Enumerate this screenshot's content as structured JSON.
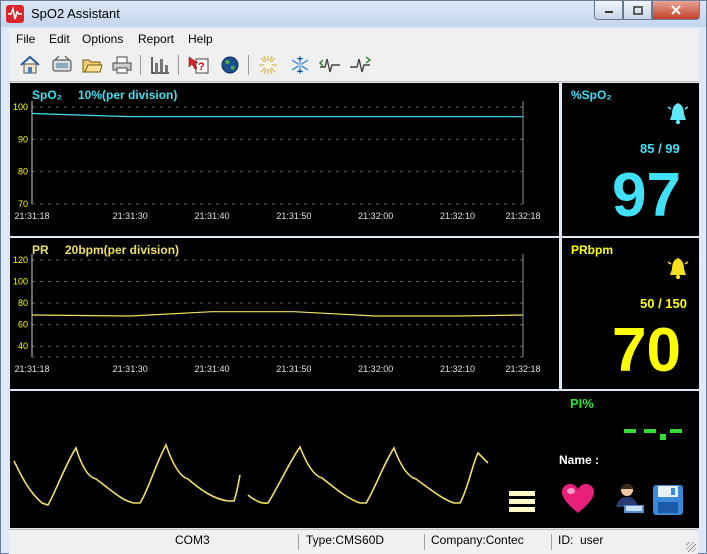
{
  "window": {
    "title": "SpO2 Assistant"
  },
  "menu": [
    "File",
    "Edit",
    "Options",
    "Report",
    "Help"
  ],
  "toolbar": [
    "home-icon",
    "device-icon",
    "open-folder-icon",
    "print-icon",
    "chart-bar-icon",
    "help-cursor-icon",
    "globe-icon",
    "sun-icon",
    "snowflake-icon",
    "waveform-left-icon",
    "waveform-right-icon"
  ],
  "spo2_graph": {
    "title": "SpO₂",
    "division": "10%(per division)",
    "y_ticks": [
      "100",
      "90",
      "80",
      "70"
    ],
    "x_ticks": [
      "21:31:18",
      "21:31:30",
      "21:31:40",
      "21:31:50",
      "21:32:00",
      "21:32:10",
      "21:32:18"
    ],
    "ylim": [
      70,
      100
    ],
    "line_color": "#40e0f0"
  },
  "pr_graph": {
    "title": "PR",
    "division": "20bpm(per division)",
    "y_ticks": [
      "120",
      "100",
      "80",
      "60",
      "40"
    ],
    "x_ticks": [
      "21:31:18",
      "21:31:30",
      "21:31:40",
      "21:31:50",
      "21:32:00",
      "21:32:10",
      "21:32:18"
    ],
    "ylim": [
      30,
      120
    ],
    "line_color": "#f0e060"
  },
  "chart_data": [
    {
      "type": "line",
      "title": "SpO₂ 10%(per division)",
      "x": [
        "21:31:18",
        "21:31:30",
        "21:31:40",
        "21:31:50",
        "21:32:00",
        "21:32:10",
        "21:32:18"
      ],
      "series": [
        {
          "values": [
            98,
            97,
            97,
            97,
            97,
            97,
            97
          ]
        }
      ],
      "ylim": [
        70,
        100
      ]
    },
    {
      "type": "line",
      "title": "PR 20bpm(per division)",
      "x": [
        "21:31:18",
        "21:31:30",
        "21:31:40",
        "21:31:50",
        "21:32:00",
        "21:32:10",
        "21:32:18"
      ],
      "series": [
        {
          "values": [
            69,
            68,
            72,
            72,
            68,
            68,
            69
          ]
        }
      ],
      "ylim": [
        30,
        120
      ]
    }
  ],
  "spo2_panel": {
    "label": "%SpO₂",
    "limits": "85 / 99",
    "value": "97",
    "color": "#40e0f8"
  },
  "pr_panel": {
    "label": "PRbpm",
    "limits": "50 / 150",
    "value": "70",
    "color": "#ffff00"
  },
  "pi_panel": {
    "label": "PI%",
    "value": "- - . -",
    "name_label": "Name :",
    "label_color": "#30e030"
  },
  "bottom_icons": [
    "bars-icon",
    "heart-icon",
    "user-icon",
    "save-icon"
  ],
  "status": {
    "port": "COM3",
    "type": "Type:CMS60D",
    "company": "Company:Contec",
    "id": "ID:  user"
  }
}
